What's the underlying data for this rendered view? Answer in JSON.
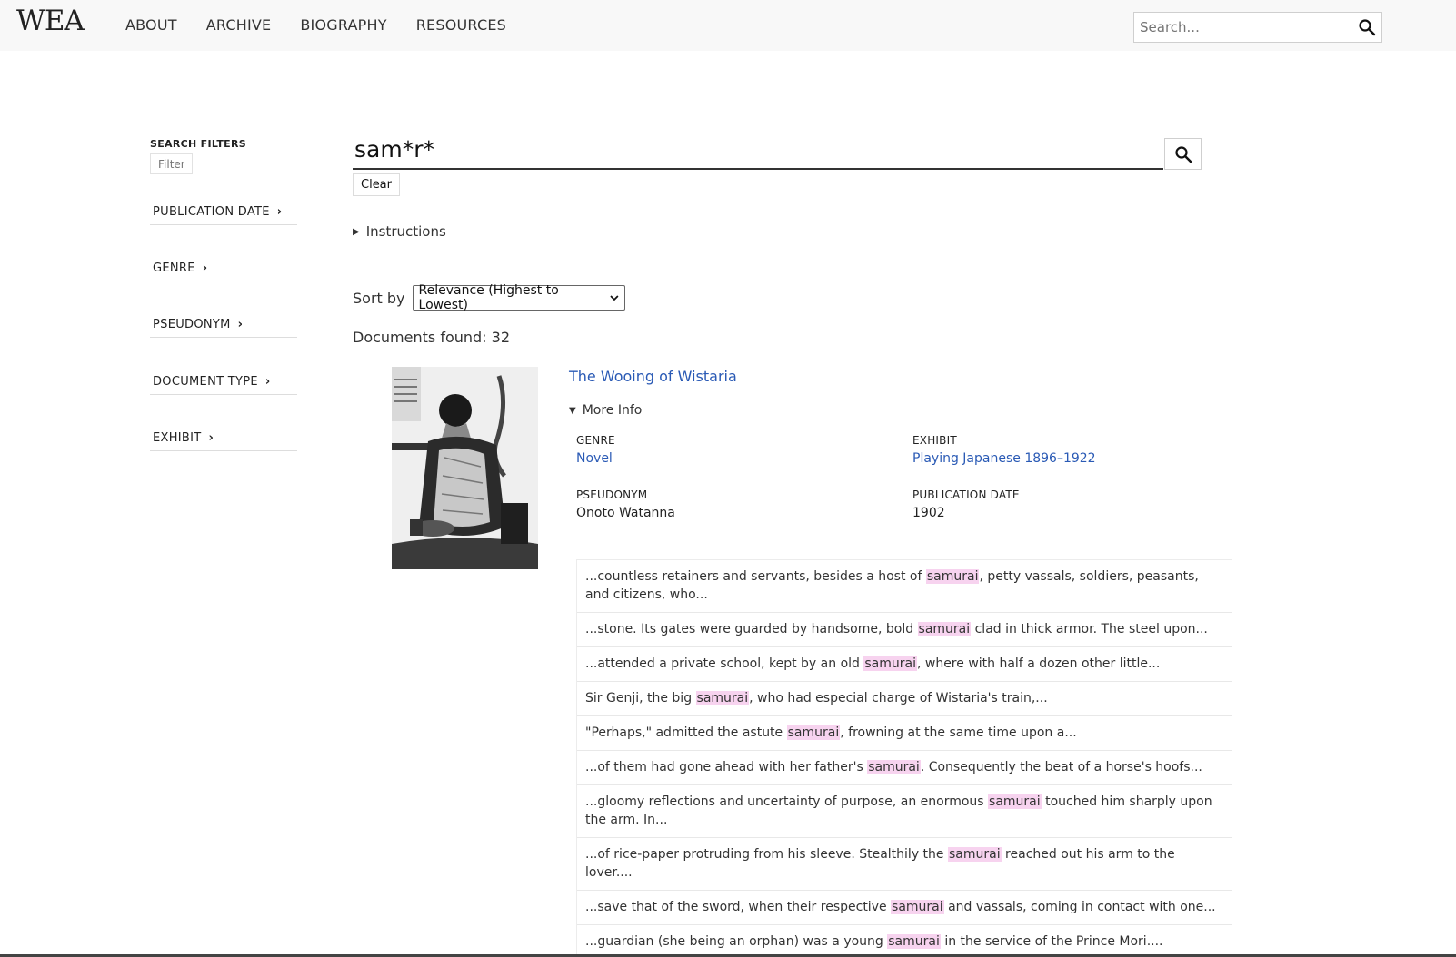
{
  "header": {
    "logo": "WEA",
    "nav": [
      "ABOUT",
      "ARCHIVE",
      "BIOGRAPHY",
      "RESOURCES"
    ],
    "search_placeholder": "Search..."
  },
  "sidebar": {
    "title": "SEARCH FILTERS",
    "filter_placeholder": "Filter",
    "facets": [
      "PUBLICATION DATE",
      "GENRE",
      "PSEUDONYM",
      "DOCUMENT TYPE",
      "EXHIBIT"
    ]
  },
  "search": {
    "query": "sam*r*",
    "clear_label": "Clear",
    "instructions_label": "Instructions",
    "sort_label": "Sort by",
    "sort_value": "Relevance (Highest to Lowest)",
    "documents_found": "Documents found: 32"
  },
  "result": {
    "title": "The Wooing of Wistaria",
    "more_info_label": "More Info",
    "genre_label": "GENRE",
    "genre_value": "Novel",
    "exhibit_label": "EXHIBIT",
    "exhibit_value": "Playing Japanese 1896–1922",
    "pseudonym_label": "PSEUDONYM",
    "pseudonym_value": "Onoto Watanna",
    "pubdate_label": "PUBLICATION DATE",
    "pubdate_value": "1902",
    "snippets": [
      {
        "before": "...countless retainers and servants, besides a host of ",
        "hit": "samurai",
        "after": ", petty vassals, soldiers, peasants, and citizens, who..."
      },
      {
        "before": "...stone. Its gates were guarded by handsome, bold ",
        "hit": "samurai",
        "after": " clad in thick armor. The steel upon..."
      },
      {
        "before": "...attended a private school, kept by an old ",
        "hit": "samurai",
        "after": ", where with half a dozen other little..."
      },
      {
        "before": "Sir Genji, the big ",
        "hit": "samurai",
        "after": ", who had especial charge of Wistaria's train,..."
      },
      {
        "before": "\"Perhaps,\" admitted the astute ",
        "hit": "samurai",
        "after": ", frowning at the same time upon a..."
      },
      {
        "before": "...of them had gone ahead with her father's ",
        "hit": "samurai",
        "after": ". Consequently the beat of a horse's hoofs..."
      },
      {
        "before": "...gloomy reflections and uncertainty of purpose, an enormous ",
        "hit": "samurai",
        "after": " touched him sharply upon the arm. In..."
      },
      {
        "before": "...of rice-paper protruding from his sleeve. Stealthily the ",
        "hit": "samurai",
        "after": " reached out his arm to the lover...."
      },
      {
        "before": "...save that of the sword, when their respective ",
        "hit": "samurai",
        "after": " and vassals, coming in contact with one..."
      },
      {
        "before": "...guardian (she being an orphan) was a young ",
        "hit": "samurai",
        "after": " in the service of the Prince Mori...."
      }
    ]
  },
  "colors": {
    "link": "#2a5ab5",
    "highlight": "#f7d3ef",
    "topbar": "#f8f8f8"
  }
}
